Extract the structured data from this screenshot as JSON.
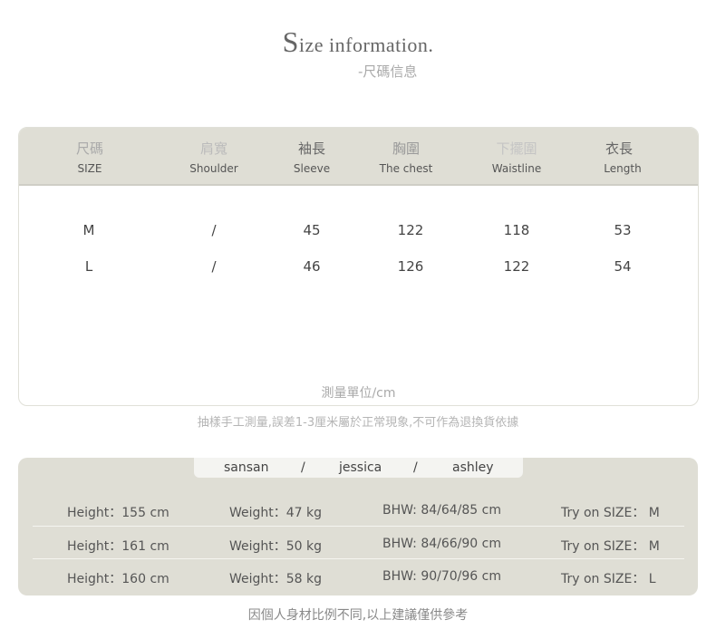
{
  "header": {
    "title_cap": "S",
    "title_rest": "ize information.",
    "subtitle": "-尺碼信息"
  },
  "size_table": {
    "columns": [
      {
        "zh": "尺碼",
        "en": "SIZE"
      },
      {
        "zh": "肩寬",
        "en": "Shoulder"
      },
      {
        "zh": "袖長",
        "en": "Sleeve"
      },
      {
        "zh": "胸圍",
        "en": "The chest"
      },
      {
        "zh": "下擺圍",
        "en": "Waistline"
      },
      {
        "zh": "衣長",
        "en": "Length"
      }
    ],
    "rows": [
      [
        "M",
        "/",
        "45",
        "122",
        "118",
        "53"
      ],
      [
        "L",
        "/",
        "46",
        "126",
        "122",
        "54"
      ]
    ],
    "unit": "測量單位/cm"
  },
  "note": "抽樣手工測量,誤差1-3厘米屬於正常現象,不可作為退換貨依據",
  "models": {
    "names": [
      "sansan",
      "/",
      "jessica",
      "/",
      "ashley"
    ],
    "rows": [
      {
        "height": "Height：155 cm",
        "weight": "Weight：47 kg",
        "bhw": "BHW: 84/64/85 cm",
        "size": "Try on SIZE：  M"
      },
      {
        "height": "Height：161 cm",
        "weight": "Weight：50 kg",
        "bhw": "BHW: 84/66/90 cm",
        "size": "Try on SIZE：  M"
      },
      {
        "height": "Height：160 cm",
        "weight": "Weight：58 kg",
        "bhw": "BHW: 90/70/96 cm",
        "size": "Try on SIZE：  L"
      }
    ]
  },
  "bottom_note": "因個人身材比例不同,以上建議僅供參考",
  "colors": {
    "header_bg": "#dfded5",
    "card_bg": "#dfded5",
    "tab_bg": "#f4f4f1"
  }
}
